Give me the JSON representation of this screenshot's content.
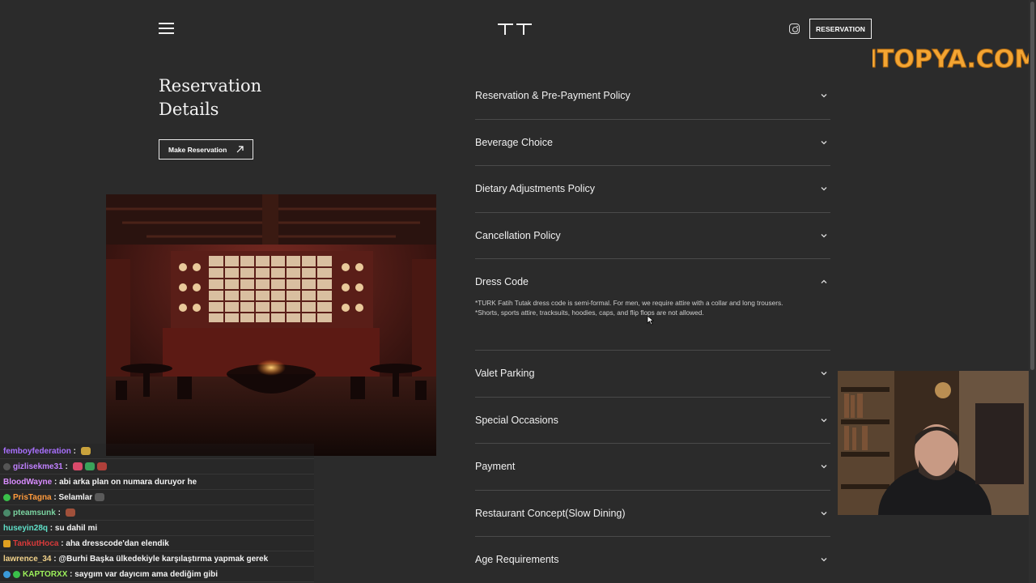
{
  "header": {
    "menu_icon": "hamburger-menu-icon",
    "logo_icon": "tt-logo-icon",
    "instagram_icon": "instagram-icon",
    "reservation_button": "RESERVATION"
  },
  "watermark": "ITOPYA.COM",
  "left": {
    "title_line1": "Reservation",
    "title_line2": "Details",
    "make_reservation": "Make Reservation"
  },
  "accordion": {
    "items": [
      {
        "label": "Reservation & Pre-Payment Policy"
      },
      {
        "label": "Beverage Choice"
      },
      {
        "label": "Dietary Adjustments Policy"
      },
      {
        "label": "Cancellation Policy"
      },
      {
        "label": "Dress Code",
        "open": true,
        "body_line1": "*TURK Fatih Tutak dress code is semi-formal. For men, we require attire with a collar and long trousers.",
        "body_line2": "*Shorts, sports attire, tracksuits, hoodies, caps, and flip flops are not allowed."
      },
      {
        "label": "Valet Parking"
      },
      {
        "label": "Special Occasions"
      },
      {
        "label": "Payment"
      },
      {
        "label": "Restaurant Concept(Slow Dining)"
      },
      {
        "label": "Age Requirements"
      }
    ]
  },
  "chat": {
    "messages": [
      {
        "user": "femboyfederation",
        "color": "#a970ff",
        "text": ""
      },
      {
        "user": "gizlisekme31",
        "color": "#c080ff",
        "text": ""
      },
      {
        "user": "BloodWayne",
        "color": "#d98cff",
        "text": "abi arka plan on numara duruyor he"
      },
      {
        "user": "PrisTagna",
        "color": "#ff9a3c",
        "text": "Selamlar"
      },
      {
        "user": "pteamsunk",
        "color": "#7ad3a0",
        "text": ""
      },
      {
        "user": "huseyin28q",
        "color": "#5fe0c8",
        "text": "su dahil mi"
      },
      {
        "user": "TankutHoca",
        "color": "#d93a3a",
        "text": "aha dresscode'dan elendik"
      },
      {
        "user": "lawrence_34",
        "color": "#f2d28a",
        "text": "@Burhi Başka ülkedekiyle karşılaştırma yapmak gerek"
      },
      {
        "user": "KAPTORXX",
        "color": "#9cf05a",
        "text": "saygım var dayıcım ama dediğim gibi"
      }
    ]
  },
  "colors": {
    "background": "#2b2b2b",
    "text": "#f0f0f0",
    "divider": "#4a4a4a"
  }
}
